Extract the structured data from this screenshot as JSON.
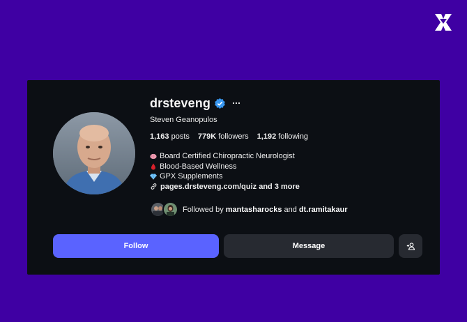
{
  "profile": {
    "username": "drsteveng",
    "full_name": "Steven Geanopulos",
    "verified": true,
    "stats": [
      {
        "count": "1,163",
        "label": "posts"
      },
      {
        "count": "779K",
        "label": "followers"
      },
      {
        "count": "1,192",
        "label": "following"
      }
    ],
    "bio": [
      {
        "icon": "brain-icon",
        "text": "Board Certified Chiropractic Neurologist"
      },
      {
        "icon": "blood-drop-icon",
        "text": "Blood-Based Wellness"
      },
      {
        "icon": "gem-icon",
        "text": "GPX Supplements"
      }
    ],
    "link": {
      "url": "pages.drsteveng.com/quiz",
      "more": " and 3 more"
    },
    "followed_by": {
      "prefix": "Followed by ",
      "user1": "mantasharocks",
      "joiner": " and ",
      "user2": "dt.ramitakaur"
    }
  },
  "actions": {
    "follow": "Follow",
    "message": "Message"
  },
  "colors": {
    "background": "#3f00a3",
    "card": "#0c0f14",
    "follow_button": "#5a63ff",
    "secondary_button": "#272a31",
    "verified": "#3897f0"
  }
}
